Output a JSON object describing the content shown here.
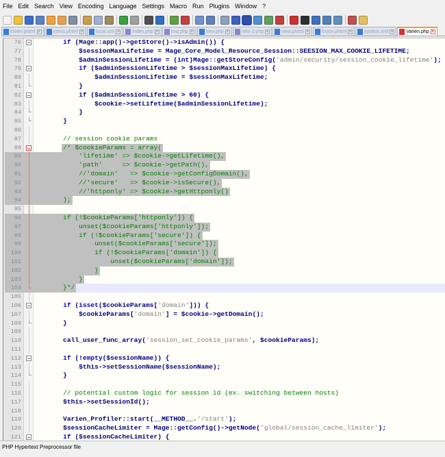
{
  "menu": [
    "File",
    "Edit",
    "Search",
    "View",
    "Encoding",
    "Language",
    "Settings",
    "Macro",
    "Run",
    "Plugins",
    "Window",
    "?"
  ],
  "toolbar_icons": [
    {
      "name": "new-file-icon",
      "color": "#f4f4f4"
    },
    {
      "name": "open-file-icon",
      "color": "#f0c040"
    },
    {
      "name": "save-icon",
      "color": "#3a6fc8"
    },
    {
      "name": "save-all-icon",
      "color": "#5a80c8"
    },
    {
      "name": "close-icon",
      "color": "#f0a040"
    },
    {
      "name": "close-all-icon",
      "color": "#e8a050"
    },
    {
      "name": "print-icon",
      "color": "#8090a0"
    },
    "sep",
    {
      "name": "cut-icon",
      "color": "#c8a050"
    },
    {
      "name": "copy-icon",
      "color": "#a0b0d0"
    },
    {
      "name": "paste-icon",
      "color": "#a08a60"
    },
    "sep",
    {
      "name": "undo-icon",
      "color": "#3aa040"
    },
    {
      "name": "redo-icon",
      "color": "#a0a0a0"
    },
    "sep",
    {
      "name": "find-icon",
      "color": "#505050"
    },
    {
      "name": "replace-icon",
      "color": "#3070c0"
    },
    "sep",
    {
      "name": "zoom-in-icon",
      "color": "#60a040"
    },
    {
      "name": "zoom-out-icon",
      "color": "#c04040"
    },
    "sep",
    {
      "name": "sync-vertical-icon",
      "color": "#7090d0"
    },
    {
      "name": "sync-horizontal-icon",
      "color": "#6080c0"
    },
    "sep",
    {
      "name": "word-wrap-icon",
      "color": "#90a0c0"
    },
    {
      "name": "show-all-chars-icon",
      "color": "#4060c0"
    },
    {
      "name": "indent-guide-icon",
      "color": "#3050b0",
      "active": true
    },
    {
      "name": "document-map-icon",
      "color": "#5090d0"
    },
    {
      "name": "function-list-icon",
      "color": "#60a060"
    },
    {
      "name": "folder-workspace-icon",
      "color": "#c04040"
    },
    "sep",
    {
      "name": "record-macro-icon",
      "color": "#d03030"
    },
    {
      "name": "stop-record-icon",
      "color": "#303030"
    },
    {
      "name": "play-macro-icon",
      "color": "#4070c0"
    },
    {
      "name": "run-macro-multiple-icon",
      "color": "#5080c0"
    },
    {
      "name": "save-macro-icon",
      "color": "#6090c0"
    },
    "sep",
    {
      "name": "spellcheck-icon",
      "color": "#c05050"
    },
    {
      "name": "plugin-icon",
      "color": "#e0c060"
    }
  ],
  "tabs": [
    {
      "label": "footer.phtml",
      "type": "blue"
    },
    {
      "label": "menu.phtml",
      "type": "blue"
    },
    {
      "label": "local.xml",
      "type": "blue"
    },
    {
      "label": "index.php",
      "type": "purple"
    },
    {
      "label": "test.php",
      "type": "purple"
    },
    {
      "label": "new.php",
      "type": "blue"
    },
    {
      "label": "new 2.php",
      "type": "purple"
    },
    {
      "label": "view.phtml",
      "type": "blue"
    },
    {
      "label": "footer.phtml",
      "type": "blue"
    },
    {
      "label": "system.xml",
      "type": "blue"
    },
    {
      "label": "Varien.php",
      "type": "red",
      "active": true
    }
  ],
  "editor": {
    "lines": [
      {
        "n": "76",
        "text": "        if (Mage::app()->getStore()->isAdmin()) {",
        "fold": "minus"
      },
      {
        "n": "77",
        "text": "            $sessionMaxLifetime = Mage_Core_Model_Resource_Session::SEESION_MAX_COOKIE_LIFETIME;",
        "fold": "line"
      },
      {
        "n": "78",
        "text": "            $adminSessionLifetime = (int)Mage::getStoreConfig('admin/security/session_cookie_lifetime');",
        "fold": "line"
      },
      {
        "n": "79",
        "text": "            if ($adminSessionLifetime > $sessionMaxLifetime) {",
        "fold": "minus"
      },
      {
        "n": "80",
        "text": "                $adminSessionLifetime = $sessionMaxLifetime;",
        "fold": "line"
      },
      {
        "n": "81",
        "text": "            }",
        "fold": "end"
      },
      {
        "n": "82",
        "text": "            if ($adminSessionLifetime > 60) {",
        "fold": "minus"
      },
      {
        "n": "83",
        "text": "                $cookie->setLifetime($adminSessionLifetime);",
        "fold": "line"
      },
      {
        "n": "84",
        "text": "            }",
        "fold": "end"
      },
      {
        "n": "85",
        "text": "        }",
        "fold": "end"
      },
      {
        "n": "86",
        "text": "",
        "fold": "line"
      },
      {
        "n": "87",
        "text": "        // session cookie params",
        "fold": "line"
      },
      {
        "n": "88",
        "text": "        /* $cookieParams = array(",
        "fold": "minus-red",
        "comment": true,
        "sel": "from-text"
      },
      {
        "n": "89",
        "text": "            'lifetime' => $cookie->getLifetime(),",
        "fold": "rline",
        "comment": true,
        "sel": "full"
      },
      {
        "n": "90",
        "text": "            'path'     => $cookie->getPath(),",
        "fold": "rline",
        "comment": true,
        "sel": "full"
      },
      {
        "n": "91",
        "text": "            //'domain'   => $cookie->getConfigDomain(),",
        "fold": "rline",
        "comment": true,
        "sel": "full"
      },
      {
        "n": "92",
        "text": "            //'secure'   => $cookie->isSecure(),",
        "fold": "rline",
        "comment": true,
        "sel": "full"
      },
      {
        "n": "93",
        "text": "            //'httponly' => $cookie->getHttponly()",
        "fold": "rline",
        "comment": true,
        "sel": "full"
      },
      {
        "n": "94",
        "text": "        );",
        "fold": "rline",
        "comment": true,
        "sel": "full"
      },
      {
        "n": "95",
        "text": "",
        "fold": "rline",
        "comment": true
      },
      {
        "n": "96",
        "text": "        if (!$cookieParams['httponly']) {",
        "fold": "rline",
        "comment": true,
        "sel": "full"
      },
      {
        "n": "97",
        "text": "            unset($cookieParams['httponly']);",
        "fold": "rline",
        "comment": true,
        "sel": "full"
      },
      {
        "n": "98",
        "text": "            if (!$cookieParams['secure']) {",
        "fold": "rline",
        "comment": true,
        "sel": "full"
      },
      {
        "n": "99",
        "text": "                unset($cookieParams['secure']);",
        "fold": "rline",
        "comment": true,
        "sel": "full"
      },
      {
        "n": "100",
        "text": "                if (!$cookieParams['domain']) {",
        "fold": "rline",
        "comment": true,
        "sel": "full"
      },
      {
        "n": "101",
        "text": "                    unset($cookieParams['domain']);",
        "fold": "rline",
        "comment": true,
        "sel": "full"
      },
      {
        "n": "102",
        "text": "                }",
        "fold": "rline",
        "comment": true,
        "sel": "full"
      },
      {
        "n": "103",
        "text": "            }",
        "fold": "rline",
        "comment": true,
        "sel": "full"
      },
      {
        "n": "104",
        "text": "        }*/",
        "fold": "rend",
        "comment": true,
        "sel": "full",
        "current": true
      },
      {
        "n": "105",
        "text": "",
        "fold": "line"
      },
      {
        "n": "106",
        "text": "        if (isset($cookieParams['domain'])) {",
        "fold": "minus"
      },
      {
        "n": "107",
        "text": "            $cookieParams['domain'] = $cookie->getDomain();",
        "fold": "line"
      },
      {
        "n": "108",
        "text": "        }",
        "fold": "end"
      },
      {
        "n": "109",
        "text": "",
        "fold": "line"
      },
      {
        "n": "110",
        "text": "        call_user_func_array('session_set_cookie_params', $cookieParams);",
        "fold": "line"
      },
      {
        "n": "111",
        "text": "",
        "fold": "line"
      },
      {
        "n": "112",
        "text": "        if (!empty($sessionName)) {",
        "fold": "minus"
      },
      {
        "n": "113",
        "text": "            $this->setSessionName($sessionName);",
        "fold": "line"
      },
      {
        "n": "114",
        "text": "        }",
        "fold": "end"
      },
      {
        "n": "115",
        "text": "",
        "fold": "line"
      },
      {
        "n": "116",
        "text": "        // potential custom logic for session id (ex. switching between hosts)",
        "fold": "line"
      },
      {
        "n": "117",
        "text": "        $this->setSessionId();",
        "fold": "line"
      },
      {
        "n": "118",
        "text": "",
        "fold": "line"
      },
      {
        "n": "119",
        "text": "        Varien_Profiler::start(__METHOD__.'/start');",
        "fold": "line"
      },
      {
        "n": "120",
        "text": "        $sessionCacheLimiter = Mage::getConfig()->getNode('global/session_cache_limiter');",
        "fold": "line"
      },
      {
        "n": "121",
        "text": "        if ($sessionCacheLimiter) {",
        "fold": "minus"
      }
    ]
  },
  "status": {
    "file_type": "PHP Hypertext Preprocessor file"
  }
}
